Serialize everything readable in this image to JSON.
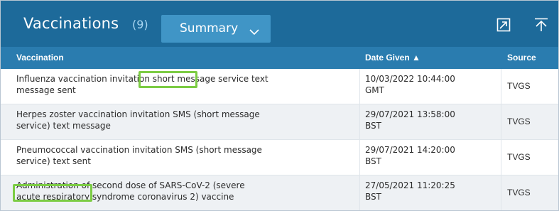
{
  "header": {
    "title": "Vaccinations",
    "count": "(9)",
    "summary_label": "Summary"
  },
  "columns": {
    "vaccination": "Vaccination",
    "date_given": "Date Given ▲",
    "source": "Source"
  },
  "rows": [
    {
      "vacc_line1": "Influenza vaccination invitation short message service text",
      "vacc_line2": "message sent",
      "date_line1": "10/03/2022 10:44:00",
      "date_line2": "GMT",
      "source": "TVGS"
    },
    {
      "vacc_line1": "Herpes zoster vaccination invitation SMS (short message",
      "vacc_line2": "service) text message",
      "date_line1": "29/07/2021 13:58:00",
      "date_line2": "BST",
      "source": "TVGS"
    },
    {
      "vacc_line1": "Pneumococcal vaccination invitation SMS (short message",
      "vacc_line2": "service) text sent",
      "date_line1": "29/07/2021 14:20:00",
      "date_line2": "BST",
      "source": "TVGS"
    },
    {
      "vacc_line1": "Administration of second dose of SARS-CoV-2 (severe",
      "vacc_line2": "acute respiratory syndrome coronavirus 2) vaccine",
      "date_line1": "27/05/2021 11:20:25",
      "date_line2": "BST",
      "source": "TVGS"
    }
  ],
  "colors": {
    "header_bg": "#1d6a9a",
    "column_header_bg": "#2a7caf",
    "summary_button_bg": "#4095c6",
    "highlight": "#7ccc44"
  },
  "icons": [
    "chevron-down-icon",
    "expand-icon",
    "scroll-to-top-icon"
  ]
}
